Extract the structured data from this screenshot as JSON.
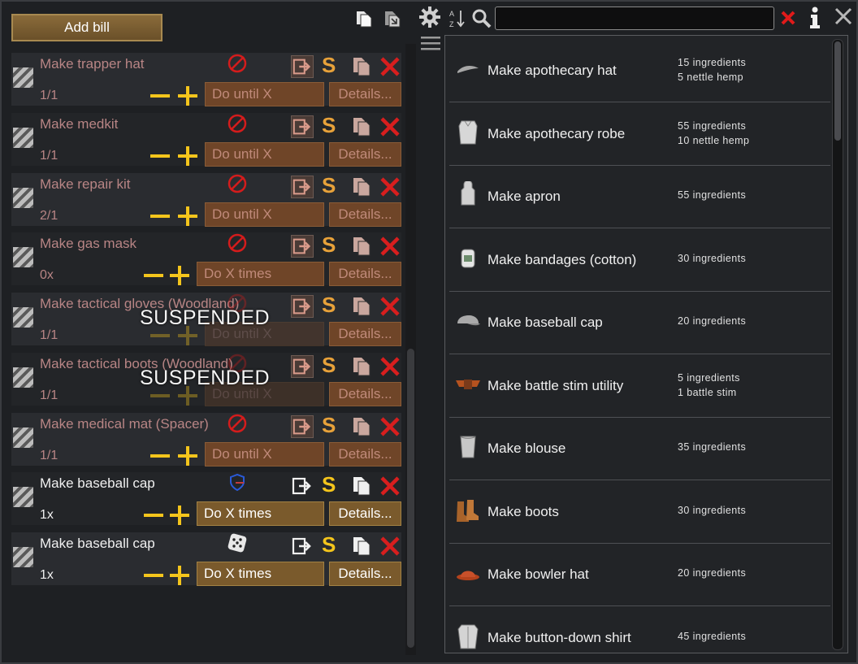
{
  "toolbar": {
    "add_bill_label": "Add bill",
    "copy_icon": "copy-icon",
    "paste_icon": "paste-icon"
  },
  "bills": [
    {
      "label": "Make trapper hat",
      "count": "1/1",
      "mode": "Do until X",
      "details": "Details...",
      "store_icon": "forbidden-icon",
      "active": false,
      "suspended": ""
    },
    {
      "label": "Make medkit",
      "count": "1/1",
      "mode": "Do until X",
      "details": "Details...",
      "store_icon": "forbidden-icon",
      "active": false,
      "suspended": ""
    },
    {
      "label": "Make repair kit",
      "count": "2/1",
      "mode": "Do until X",
      "details": "Details...",
      "store_icon": "forbidden-icon",
      "active": false,
      "suspended": ""
    },
    {
      "label": "Make gas mask",
      "count": "0x",
      "mode": "Do X times",
      "details": "Details...",
      "store_icon": "forbidden-icon",
      "active": false,
      "suspended": ""
    },
    {
      "label": "Make tactical gloves (Woodland)",
      "count": "1/1",
      "mode": "Do until X",
      "details": "Details...",
      "store_icon": "forbidden-icon",
      "active": false,
      "suspended": "SUSPENDED"
    },
    {
      "label": "Make tactical boots (Woodland)",
      "count": "1/1",
      "mode": "Do until X",
      "details": "Details...",
      "store_icon": "forbidden-icon",
      "active": false,
      "suspended": "SUSPENDED"
    },
    {
      "label": "Make medical mat (Spacer)",
      "count": "1/1",
      "mode": "Do until X",
      "details": "Details...",
      "store_icon": "forbidden-icon",
      "active": false,
      "suspended": ""
    },
    {
      "label": "Make baseball cap",
      "count": "1x",
      "mode": "Do X times",
      "details": "Details...",
      "store_icon": "shield-icon",
      "active": true,
      "suspended": ""
    },
    {
      "label": "Make baseball cap",
      "count": "1x",
      "mode": "Do X times",
      "details": "Details...",
      "store_icon": "dice-icon",
      "active": true,
      "suspended": ""
    }
  ],
  "search": {
    "value": "",
    "settings_icon": "gear-icon",
    "sort_icon": "sort-az-icon",
    "search_icon": "magnifier-icon",
    "clear_icon": "clear-x-icon",
    "info_icon": "info-icon",
    "close_icon": "close-icon",
    "menu_icon": "hamburger-icon"
  },
  "recipes": [
    {
      "label": "Make apothecary hat",
      "ingredients": [
        "15 ingredients",
        "5 nettle hemp"
      ],
      "icon": "hat-icon"
    },
    {
      "label": "Make apothecary robe",
      "ingredients": [
        "55 ingredients",
        "10 nettle hemp"
      ],
      "icon": "robe-icon"
    },
    {
      "label": "Make apron",
      "ingredients": [
        "55 ingredients"
      ],
      "icon": "apron-icon"
    },
    {
      "label": "Make bandages (cotton)",
      "ingredients": [
        "30 ingredients"
      ],
      "icon": "bandage-icon"
    },
    {
      "label": "Make baseball cap",
      "ingredients": [
        "20 ingredients"
      ],
      "icon": "cap-icon"
    },
    {
      "label": "Make battle stim utility",
      "ingredients": [
        "5 ingredients",
        "1 battle stim"
      ],
      "icon": "belt-icon"
    },
    {
      "label": "Make blouse",
      "ingredients": [
        "35 ingredients"
      ],
      "icon": "blouse-icon"
    },
    {
      "label": "Make boots",
      "ingredients": [
        "30 ingredients"
      ],
      "icon": "boots-icon"
    },
    {
      "label": "Make bowler hat",
      "ingredients": [
        "20 ingredients"
      ],
      "icon": "bowler-hat-icon"
    },
    {
      "label": "Make button-down shirt",
      "ingredients": [
        "45 ingredients"
      ],
      "icon": "shirt-icon"
    }
  ],
  "colors": {
    "accent_gold": "#f4c51c",
    "danger_red": "#d81e1e",
    "inactive_text": "#b88585"
  }
}
